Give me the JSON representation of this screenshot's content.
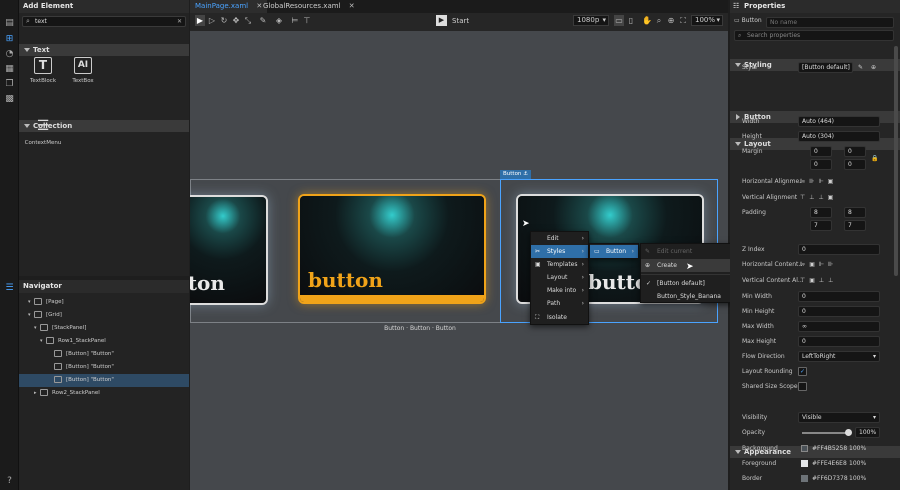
{
  "add_element": {
    "title": "Add Element",
    "search_value": "text",
    "section_text": "Text",
    "items_text": [
      {
        "label": "TextBlock"
      },
      {
        "label": "TextBox"
      }
    ],
    "section_collection": "Collection",
    "items_collection": [
      {
        "label": "ContextMenu"
      }
    ]
  },
  "navigator": {
    "title": "Navigator",
    "rows": [
      {
        "label": "[Page]"
      },
      {
        "label": "[Grid]"
      },
      {
        "label": "[StackPanel]"
      },
      {
        "label": "Row1_StackPanel"
      },
      {
        "label": "[Button] \"Button\""
      },
      {
        "label": "[Button] \"Button\""
      },
      {
        "label": "[Button] \"Button\""
      },
      {
        "label": "Row2_StackPanel"
      }
    ]
  },
  "tabs": [
    {
      "label": "MainPage.xaml"
    },
    {
      "label": "GlobalResources.xaml"
    }
  ],
  "toolbar": {
    "start": "Start",
    "resolution": "1080p",
    "zoom": "100%"
  },
  "canvas": {
    "selection_tag": "Button",
    "card_title": "button",
    "buttons_caption": "Button · Button · Button"
  },
  "context_menu": {
    "items": [
      {
        "label": "Edit"
      },
      {
        "label": "Styles"
      },
      {
        "label": "Templates"
      },
      {
        "label": "Layout"
      },
      {
        "label": "Make into"
      },
      {
        "label": "Path"
      },
      {
        "label": "Isolate"
      }
    ],
    "submenu": {
      "label": "Button"
    },
    "style_menu": {
      "edit_current": "Edit current",
      "create": "Create",
      "options": [
        "[Button default]",
        "Button_Style_Banana"
      ]
    }
  },
  "properties": {
    "title": "Properties",
    "element_type": "Button",
    "name_placeholder": "No name",
    "search_placeholder": "Search properties",
    "styling": "Styling",
    "style_label": "Style",
    "style_value": "[Button default]",
    "button_section": "Button",
    "layout_section": "Layout",
    "width_label": "Width",
    "width_value": "Auto (464)",
    "height_label": "Height",
    "height_value": "Auto (304)",
    "margin_label": "Margin",
    "margin_values": [
      "0",
      "0",
      "0",
      "0"
    ],
    "halign_label": "Horizontal Alignme...",
    "valign_label": "Vertical Alignment",
    "padding_label": "Padding",
    "padding_values": [
      "8",
      "8",
      "7",
      "7"
    ],
    "zindex_label": "Z Index",
    "zindex_value": "0",
    "hcontent_label": "Horizontal Content...",
    "vcontent_label": "Vertical Content Al...",
    "minwidth_label": "Min Width",
    "minwidth_value": "0",
    "minheight_label": "Min Height",
    "minheight_value": "0",
    "maxwidth_label": "Max Width",
    "maxwidth_value": "∞",
    "maxheight_label": "Max Height",
    "maxheight_value": "0",
    "flow_label": "Flow Direction",
    "flow_value": "LeftToRight",
    "rounding_label": "Layout Rounding",
    "shared_label": "Shared Size Scope",
    "appearance_section": "Appearance",
    "visibility_label": "Visibility",
    "visibility_value": "Visible",
    "opacity_label": "Opacity",
    "opacity_value": "100%",
    "background_label": "Background",
    "background_value": "#FF4B5258",
    "background_pct": "100%",
    "foreground_label": "Foreground",
    "foreground_value": "#FFE4E6E8",
    "foreground_pct": "100%",
    "border_label": "Border",
    "border_value": "#FF6D7378",
    "border_pct": "100%"
  },
  "colors": {
    "accent": "#2f6fa8",
    "orange": "#f0a319",
    "card_text": "#f0a319"
  }
}
